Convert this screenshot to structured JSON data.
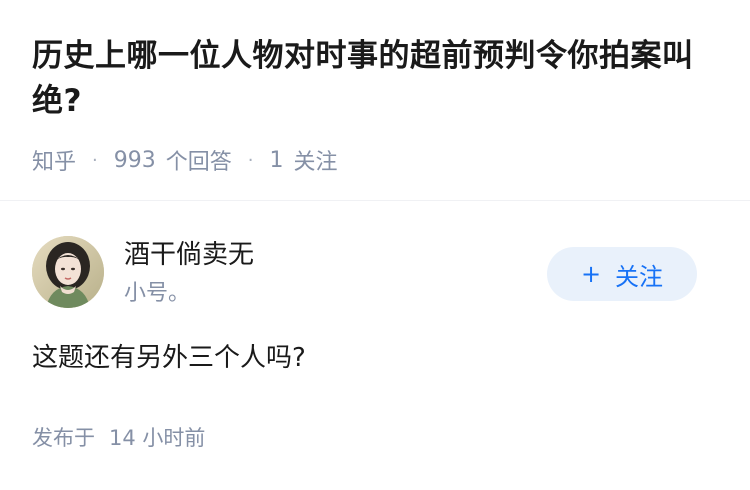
{
  "question": {
    "title": "历史上哪一位人物对时事的超前预判令你拍案叫绝?",
    "source": "知乎",
    "separator": "·",
    "answers_count": "993",
    "answers_label": "个回答",
    "follow_count": "1",
    "follow_label": "关注"
  },
  "answer": {
    "author": {
      "name": "酒干倘卖无",
      "bio": "小号。",
      "avatar_icon": "user-avatar"
    },
    "follow_button": {
      "icon": "+",
      "label": "关注"
    },
    "content": "这题还有另外三个人吗?",
    "publish": {
      "label": "发布于",
      "time": "14 小时前"
    }
  },
  "colors": {
    "text_primary": "#1a1a1a",
    "text_secondary": "#8590a6",
    "accent_blue": "#1772f6",
    "button_bg": "#e9f1fb",
    "divider": "#f0f1f4"
  }
}
